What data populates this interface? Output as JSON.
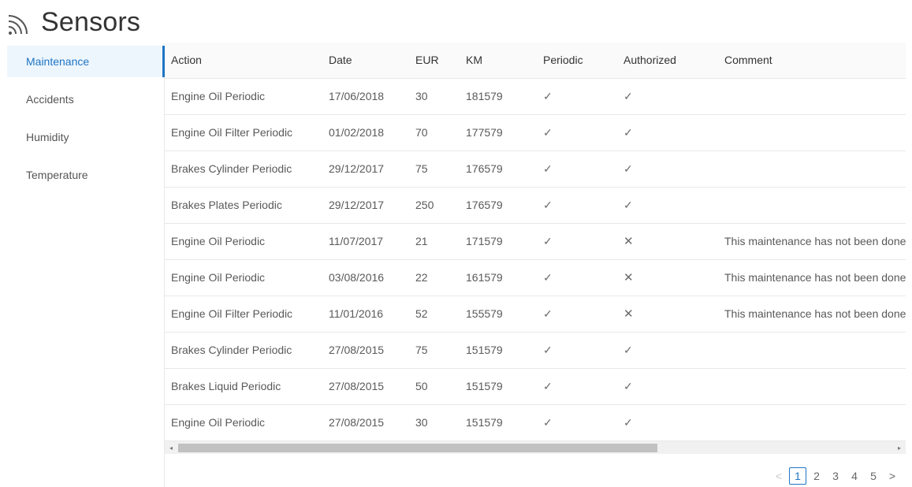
{
  "page": {
    "title": "Sensors",
    "icon": "wifi-signal-icon",
    "accent": "#1f75c4"
  },
  "sidebar": {
    "items": [
      {
        "label": "Maintenance",
        "active": true
      },
      {
        "label": "Accidents"
      },
      {
        "label": "Humidity"
      },
      {
        "label": "Temperature"
      }
    ]
  },
  "table": {
    "columns": [
      "Action",
      "Date",
      "EUR",
      "KM",
      "Periodic",
      "Authorized",
      "Comment"
    ],
    "rows": [
      {
        "action": "Engine Oil Periodic",
        "date": "17/06/2018",
        "eur": "30",
        "km": "181579",
        "periodic": "✓",
        "authorized": "✓",
        "comment": ""
      },
      {
        "action": "Engine Oil Filter Periodic",
        "date": "01/02/2018",
        "eur": "70",
        "km": "177579",
        "periodic": "✓",
        "authorized": "✓",
        "comment": ""
      },
      {
        "action": "Brakes Cylinder Periodic",
        "date": "29/12/2017",
        "eur": "75",
        "km": "176579",
        "periodic": "✓",
        "authorized": "✓",
        "comment": ""
      },
      {
        "action": "Brakes Plates Periodic",
        "date": "29/12/2017",
        "eur": "250",
        "km": "176579",
        "periodic": "✓",
        "authorized": "✓",
        "comment": ""
      },
      {
        "action": "Engine Oil Periodic",
        "date": "11/07/2017",
        "eur": "21",
        "km": "171579",
        "periodic": "✓",
        "authorized": "✕",
        "comment": "This maintenance has not been done"
      },
      {
        "action": "Engine Oil Periodic",
        "date": "03/08/2016",
        "eur": "22",
        "km": "161579",
        "periodic": "✓",
        "authorized": "✕",
        "comment": "This maintenance has not been done"
      },
      {
        "action": "Engine Oil Filter Periodic",
        "date": "11/01/2016",
        "eur": "52",
        "km": "155579",
        "periodic": "✓",
        "authorized": "✕",
        "comment": "This maintenance has not been done"
      },
      {
        "action": "Brakes Cylinder Periodic",
        "date": "27/08/2015",
        "eur": "75",
        "km": "151579",
        "periodic": "✓",
        "authorized": "✓",
        "comment": ""
      },
      {
        "action": "Brakes Liquid Periodic",
        "date": "27/08/2015",
        "eur": "50",
        "km": "151579",
        "periodic": "✓",
        "authorized": "✓",
        "comment": ""
      },
      {
        "action": "Engine Oil Periodic",
        "date": "27/08/2015",
        "eur": "30",
        "km": "151579",
        "periodic": "✓",
        "authorized": "✓",
        "comment": ""
      }
    ]
  },
  "pagination": {
    "prev": "<",
    "next": ">",
    "pages": [
      "1",
      "2",
      "3",
      "4",
      "5"
    ],
    "current": "1"
  },
  "scrollbar": {
    "left_arrow": "◂",
    "right_arrow": "▸"
  }
}
